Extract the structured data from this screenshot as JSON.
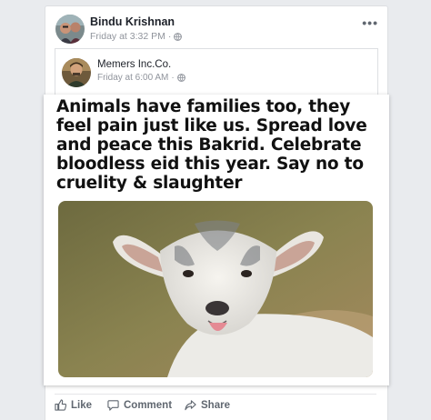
{
  "post": {
    "author": "Bindu Krishnan",
    "time": "Friday at 3:32 PM",
    "separator": "·",
    "more_label": "•••"
  },
  "shared": {
    "author": "Memers Inc.Co.",
    "time": "Friday at 6:00 AM",
    "separator": "·",
    "meme_text": "Animals have families too, they feel pain just like us. Spread love and peace this Bakrid. Celebrate bloodless eid this year. Say no to cruelity & slaughter"
  },
  "actions": {
    "like": "Like",
    "comment": "Comment",
    "share": "Share"
  },
  "colors": {
    "background": "#e9ebee",
    "meta_gray": "#90949c",
    "action_gray": "#606770"
  },
  "icons": [
    "globe-icon",
    "more-icon",
    "like-icon",
    "comment-icon",
    "share-icon"
  ]
}
